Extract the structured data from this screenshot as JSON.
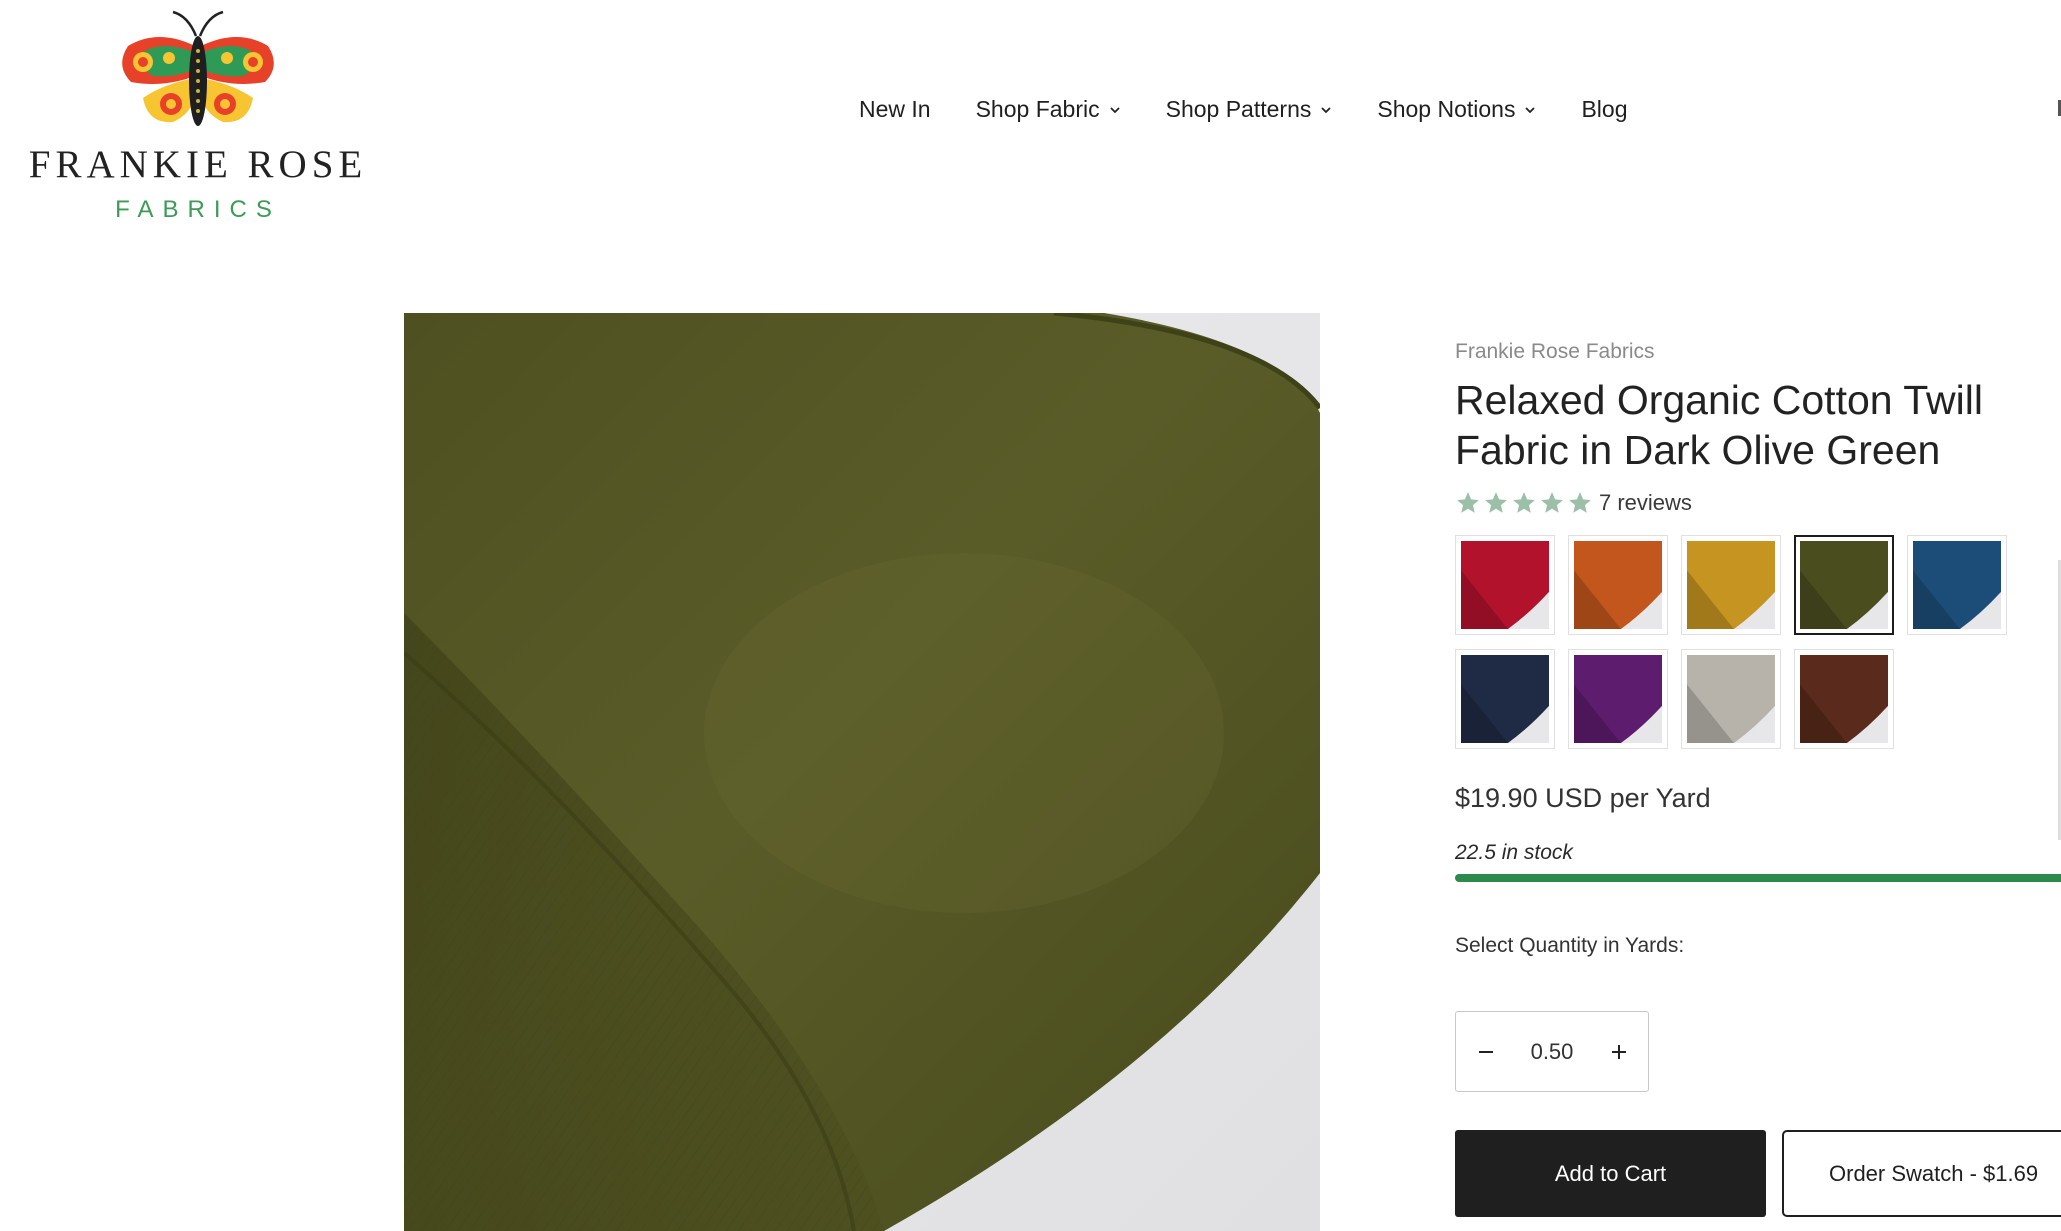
{
  "brand": {
    "name": "FRANKIE ROSE",
    "sub": "FABRICS"
  },
  "nav": {
    "items": [
      {
        "label": "New In",
        "dropdown": false
      },
      {
        "label": "Shop Fabric",
        "dropdown": true
      },
      {
        "label": "Shop Patterns",
        "dropdown": true
      },
      {
        "label": "Shop Notions",
        "dropdown": true
      },
      {
        "label": "Blog",
        "dropdown": false
      }
    ]
  },
  "product": {
    "vendor": "Frankie Rose Fabrics",
    "title": "Relaxed Organic Cotton Twill Fabric in Dark Olive Green",
    "rating_stars": 5,
    "reviews_label": "7 reviews",
    "price": "$19.90 USD per Yard",
    "stock_label": "22.5 in stock",
    "stock_fill_fraction": 1.0,
    "quantity_label": "Select Quantity in Yards:",
    "quantity_value": "0.50",
    "add_to_cart_label": "Add to Cart",
    "order_swatch_label": "Order Swatch - $1.69",
    "swatches": [
      {
        "color": "#b3122c",
        "selected": false
      },
      {
        "color": "#c2561d",
        "selected": false
      },
      {
        "color": "#c69420",
        "selected": false
      },
      {
        "color": "#4a4e1f",
        "selected": true
      },
      {
        "color": "#1c4d78",
        "selected": false
      },
      {
        "color": "#1f2a44",
        "selected": false
      },
      {
        "color": "#5e1c6e",
        "selected": false
      },
      {
        "color": "#b7b3ab",
        "selected": false
      },
      {
        "color": "#5a2a1c",
        "selected": false
      }
    ]
  },
  "colors": {
    "fabric": "#525422",
    "star": "#9cbfa8",
    "stock_bar": "#2d8a4d",
    "brand_green": "#3d9a57"
  }
}
